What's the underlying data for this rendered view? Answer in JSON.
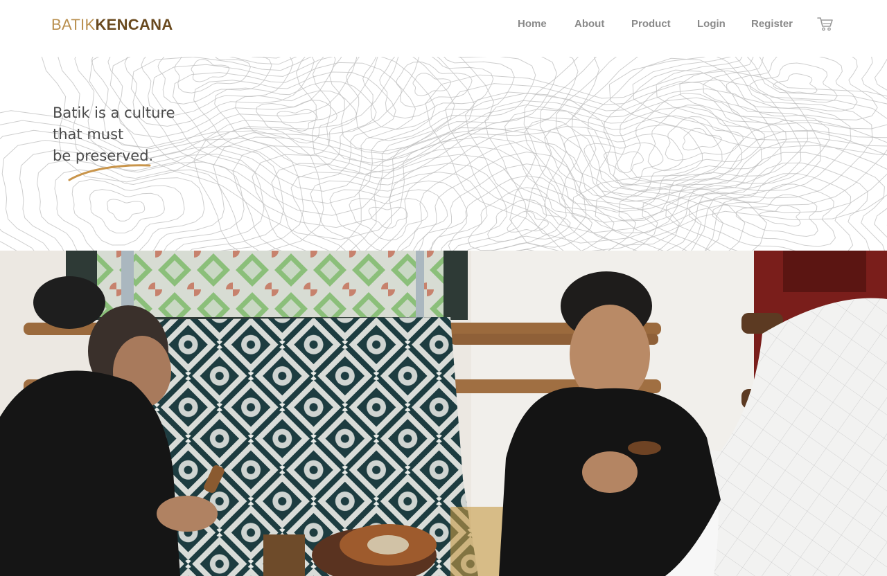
{
  "brand": {
    "light": "BATIK",
    "bold": "KENCANA"
  },
  "nav": {
    "home": "Home",
    "about": "About",
    "product": "Product",
    "login": "Login",
    "register": "Register",
    "cart_icon": "shopping-cart-icon"
  },
  "hero": {
    "line1": "Batik is a culture",
    "line2": "that must",
    "line3": "be preserved."
  },
  "colors": {
    "brand_light": "#b98f4f",
    "brand_dark": "#6a4a1f",
    "accent": "#c9954b",
    "nav_text": "#8a8a8a",
    "contour": "#bdbdbd"
  }
}
